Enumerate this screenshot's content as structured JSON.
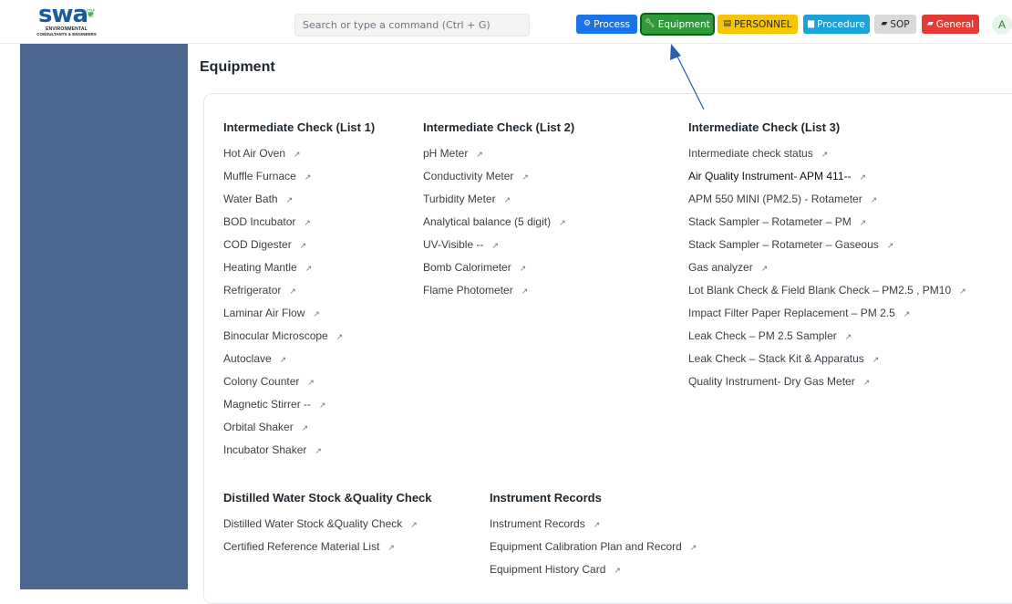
{
  "brand": {
    "logo_text": "swa",
    "tagline1": "ENVIRONMENTAL",
    "tagline2": "CONSULTANTS & ENGINEERS"
  },
  "search": {
    "placeholder": "Search or type a command (Ctrl + G)"
  },
  "nav": [
    {
      "label": "Process",
      "icon": "gear-icon",
      "color": "#1a73e8"
    },
    {
      "label": "Equipment",
      "icon": "wrench-icon",
      "color": "#2e9a3a"
    },
    {
      "label": "PERSONNEL",
      "icon": "id-card-icon",
      "color": "#f7c500"
    },
    {
      "label": "Procedure",
      "icon": "document-icon",
      "color": "#1aa3d9"
    },
    {
      "label": "SOP",
      "icon": "book-icon",
      "color": "#d9d9d9"
    },
    {
      "label": "General",
      "icon": "book-icon",
      "color": "#e53935"
    }
  ],
  "user": {
    "initial": "A"
  },
  "page": {
    "title": "Equipment"
  },
  "sections": [
    {
      "title": "Intermediate Check (List 1)",
      "links": [
        "Hot Air Oven",
        "Muffle Furnace",
        "Water Bath",
        "BOD Incubator",
        "COD Digester",
        "Heating Mantle",
        "Refrigerator",
        "Laminar Air Flow",
        "Binocular Microscope",
        "Autoclave",
        "Colony Counter",
        "Magnetic Stirrer --",
        "Orbital Shaker",
        "Incubator Shaker"
      ]
    },
    {
      "title": "Intermediate Check (List 2)",
      "links": [
        "pH Meter",
        "Conductivity Meter",
        "Turbidity Meter",
        "Analytical balance (5 digit)",
        "UV-Visible --",
        "Bomb Calorimeter",
        "Flame Photometer"
      ]
    },
    {
      "title": "Intermediate Check (List 3)",
      "links": [
        "Intermediate check status",
        "Air Quality Instrument- APM 411--",
        "APM 550 MINI (PM2.5) - Rotameter",
        "Stack Sampler – Rotameter – PM",
        "Stack Sampler – Rotameter – Gaseous",
        "Gas analyzer",
        "Lot Blank Check & Field Blank Check – PM2.5 , PM10",
        "Impact Filter Paper Replacement – PM 2.5",
        "Leak Check – PM 2.5 Sampler",
        "Leak Check – Stack Kit & Apparatus",
        "Quality Instrument- Dry Gas Meter"
      ]
    },
    {
      "title": "Distilled Water Stock &Quality Check",
      "links": [
        "Distilled Water Stock &Quality Check",
        "Certified Reference Material List"
      ]
    },
    {
      "title": "Instrument Records",
      "links": [
        "Instrument Records",
        "Equipment Calibration Plan and Record",
        "Equipment History Card"
      ]
    }
  ],
  "colors": {
    "sidebar": "#4d6890",
    "pointer": "#2a5db0"
  }
}
